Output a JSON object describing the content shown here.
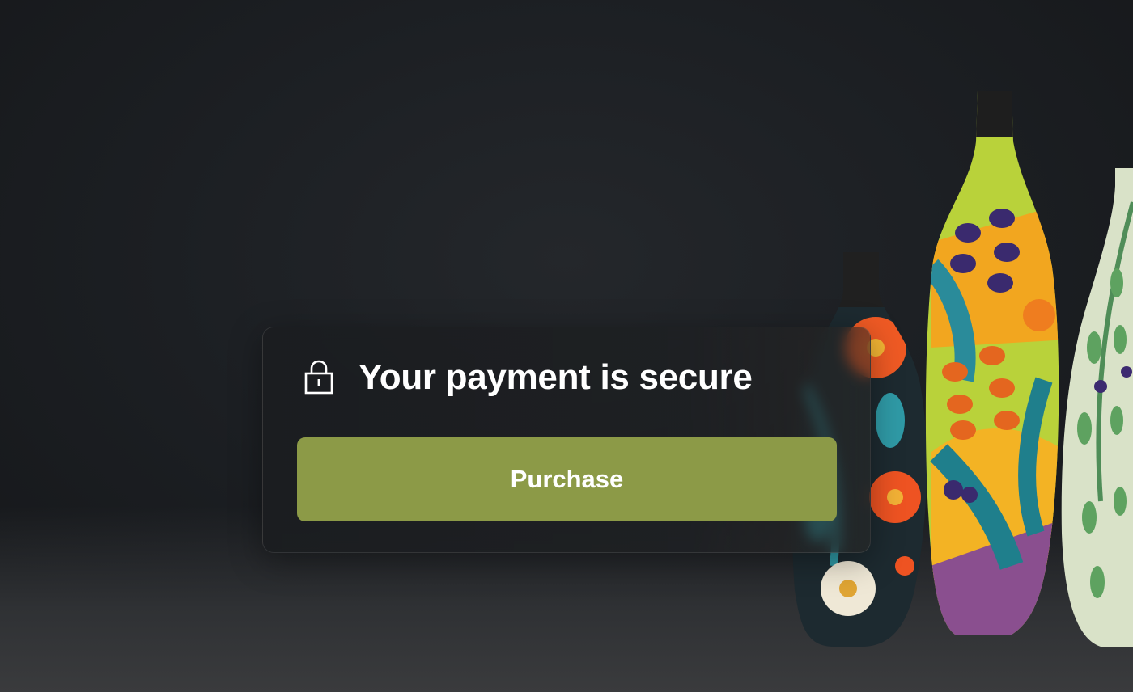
{
  "card": {
    "title": "Your payment is secure",
    "icon": "lock-icon",
    "button_label": "Purchase"
  },
  "colors": {
    "background": "#1c1f23",
    "button": "#8c9a47",
    "text": "#ffffff"
  }
}
